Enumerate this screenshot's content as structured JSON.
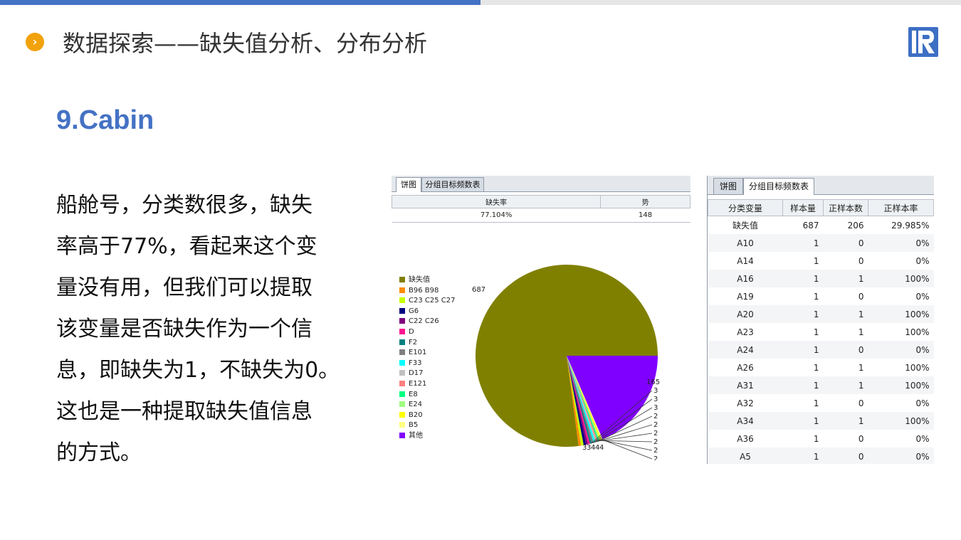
{
  "slide": {
    "title": "数据探索——缺失值分析、分布分析",
    "heading": "9.Cabin",
    "body_lines": [
      "船舱号，分类数很多，缺失",
      "率高于77%，看起来这个变",
      "量没有用，但我们可以提取",
      "该变量是否缺失作为一个信",
      "息，即缺失为1，不缺失为0。",
      "这也是一种提取缺失值信息",
      "的方式。"
    ],
    "bullet_icon": "chevron-right-icon",
    "logo_icon": "r-logo-icon",
    "accent_color": "#4472c4",
    "bullet_color": "#f2a20c"
  },
  "panel1": {
    "tabs": [
      "饼图",
      "分组目标频数表"
    ],
    "active_tab": 0,
    "columns": [
      "缺失率",
      "势"
    ],
    "row": [
      "77.104%",
      "148"
    ],
    "legend": [
      {
        "label": "缺失值",
        "color": "#808000"
      },
      {
        "label": "B96 B98",
        "color": "#ff8c00"
      },
      {
        "label": "C23 C25 C27",
        "color": "#c8ff00"
      },
      {
        "label": "G6",
        "color": "#000080"
      },
      {
        "label": "C22 C26",
        "color": "#800080"
      },
      {
        "label": "D",
        "color": "#ff1493"
      },
      {
        "label": "F2",
        "color": "#008080"
      },
      {
        "label": "E101",
        "color": "#808080"
      },
      {
        "label": "F33",
        "color": "#00ffff"
      },
      {
        "label": "D17",
        "color": "#c0c0c0"
      },
      {
        "label": "E121",
        "color": "#ff8080"
      },
      {
        "label": "E8",
        "color": "#00ff80"
      },
      {
        "label": "E24",
        "color": "#a0ff80"
      },
      {
        "label": "B20",
        "color": "#ffff00"
      },
      {
        "label": "B5",
        "color": "#ffff80"
      },
      {
        "label": "其他",
        "color": "#8000ff"
      }
    ]
  },
  "chart_data": {
    "type": "pie",
    "slices": [
      {
        "label": "缺失值",
        "value": 687
      },
      {
        "label": "B96 B98",
        "value": 4
      },
      {
        "label": "C23 C25 C27",
        "value": 4
      },
      {
        "label": "G6",
        "value": 4
      },
      {
        "label": "C22 C26",
        "value": 3
      },
      {
        "label": "D",
        "value": 3
      },
      {
        "label": "F2",
        "value": 3
      },
      {
        "label": "E101",
        "value": 3
      },
      {
        "label": "F33",
        "value": 3
      },
      {
        "label": "D17",
        "value": 2
      },
      {
        "label": "E121",
        "value": 2
      },
      {
        "label": "E8",
        "value": 2
      },
      {
        "label": "E24",
        "value": 2
      },
      {
        "label": "B20",
        "value": 2
      },
      {
        "label": "B5",
        "value": 2
      },
      {
        "label": "其他",
        "value": 165
      }
    ],
    "legend_position": "left"
  },
  "panel2": {
    "tabs": [
      "饼图",
      "分组目标频数表"
    ],
    "active_tab": 1,
    "columns": [
      "分类变量",
      "样本量",
      "正样本数",
      "正样本率"
    ],
    "rows": [
      [
        "缺失值",
        "687",
        "206",
        "29.985%"
      ],
      [
        "A10",
        "1",
        "0",
        "0%"
      ],
      [
        "A14",
        "1",
        "0",
        "0%"
      ],
      [
        "A16",
        "1",
        "1",
        "100%"
      ],
      [
        "A19",
        "1",
        "0",
        "0%"
      ],
      [
        "A20",
        "1",
        "1",
        "100%"
      ],
      [
        "A23",
        "1",
        "1",
        "100%"
      ],
      [
        "A24",
        "1",
        "0",
        "0%"
      ],
      [
        "A26",
        "1",
        "1",
        "100%"
      ],
      [
        "A31",
        "1",
        "1",
        "100%"
      ],
      [
        "A32",
        "1",
        "0",
        "0%"
      ],
      [
        "A34",
        "1",
        "1",
        "100%"
      ],
      [
        "A36",
        "1",
        "0",
        "0%"
      ],
      [
        "A5",
        "1",
        "0",
        "0%"
      ]
    ]
  }
}
